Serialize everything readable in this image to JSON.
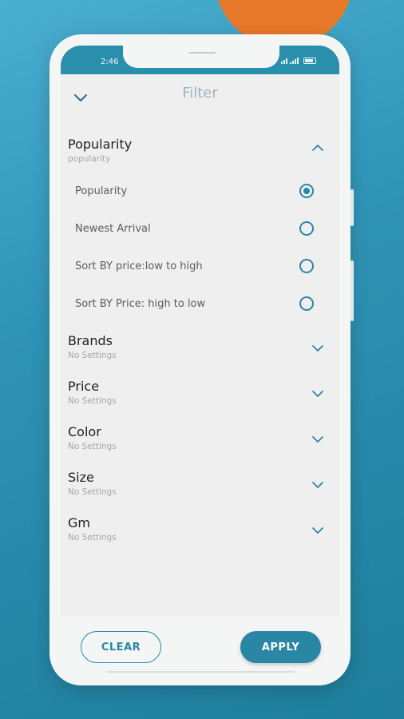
{
  "status_bar": {
    "time": "2:46"
  },
  "header": {
    "title": "Filter"
  },
  "sections": [
    {
      "title": "Popularity",
      "subtitle": "popularity",
      "expanded": true,
      "options": [
        {
          "label": "Popularity",
          "selected": true
        },
        {
          "label": "Newest Arrival",
          "selected": false
        },
        {
          "label": "Sort BY price:low to high",
          "selected": false
        },
        {
          "label": "Sort BY Price: high to low",
          "selected": false
        }
      ]
    },
    {
      "title": "Brands",
      "subtitle": "No Settings",
      "expanded": false
    },
    {
      "title": "Price",
      "subtitle": "No Settings",
      "expanded": false
    },
    {
      "title": "Color",
      "subtitle": "No Settings",
      "expanded": false
    },
    {
      "title": "Size",
      "subtitle": "No Settings",
      "expanded": false
    },
    {
      "title": "Gm",
      "subtitle": "No Settings",
      "expanded": false
    }
  ],
  "footer": {
    "clear_label": "CLEAR",
    "apply_label": "APPLY"
  },
  "colors": {
    "accent": "#2a86a5",
    "status_bar": "#2a8fad",
    "background_orange": "#e8792b"
  }
}
